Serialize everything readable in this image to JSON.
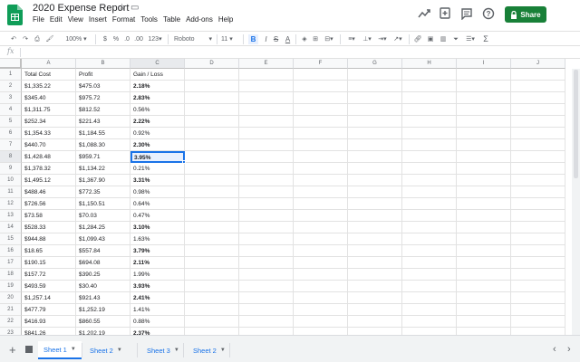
{
  "app": {
    "doc_title": "2020 Expense Report",
    "menu": [
      "File",
      "Edit",
      "View",
      "Insert",
      "Format",
      "Tools",
      "Table",
      "Add-ons",
      "Help"
    ],
    "share_label": "Share",
    "brand_color": "#188038",
    "accent_color": "#1a73e8"
  },
  "toolbar": {
    "zoom": "100%",
    "currency": "$",
    "percent": "%",
    "decimals_less": ".0",
    "decimals_more": ".00",
    "format_more": "123",
    "font": "Roboto",
    "font_size": "11",
    "bold": "B",
    "italic": "I",
    "strike": "S",
    "text_color": "A",
    "functions": "Σ"
  },
  "formula_bar": {
    "fx": "fx",
    "value": ""
  },
  "grid": {
    "columns": [
      "A",
      "B",
      "C",
      "D",
      "E",
      "F",
      "G",
      "H",
      "I",
      "J"
    ],
    "row_numbers": [
      "1",
      "2",
      "3",
      "4",
      "5",
      "6",
      "7",
      "8",
      "9",
      "10",
      "11",
      "12",
      "13",
      "14",
      "15",
      "16",
      "17",
      "18",
      "19",
      "20",
      "21",
      "22",
      "23"
    ],
    "rows": [
      [
        "Total Cost",
        "Profit",
        "Gain / Loss"
      ],
      [
        "$1,335.22",
        "$475.03",
        "2.18%"
      ],
      [
        "$345.40",
        "$975.72",
        "2.83%"
      ],
      [
        "$1,311.75",
        "$812.52",
        "0.56%"
      ],
      [
        "$252.34",
        "$221.43",
        "2.22%"
      ],
      [
        "$1,354.33",
        "$1,184.55",
        "0.92%"
      ],
      [
        "$440.70",
        "$1,088.30",
        "2.30%"
      ],
      [
        "$1,428.48",
        "$959.71",
        "3.95%"
      ],
      [
        "$1,378.32",
        "$1,134.22",
        "0.21%"
      ],
      [
        "$1,495.12",
        "$1,367.90",
        "3.31%"
      ],
      [
        "$488.46",
        "$772.35",
        "0.98%"
      ],
      [
        "$726.56",
        "$1,150.51",
        "0.64%"
      ],
      [
        "$73.58",
        "$70.03",
        "0.47%"
      ],
      [
        "$528.33",
        "$1,284.25",
        "3.10%"
      ],
      [
        "$944.88",
        "$1,099.43",
        "1.63%"
      ],
      [
        "$18.65",
        "$557.84",
        "3.79%"
      ],
      [
        "$190.15",
        "$694.08",
        "2.11%"
      ],
      [
        "$157.72",
        "$390.25",
        "1.99%"
      ],
      [
        "$493.59",
        "$30.40",
        "3.93%"
      ],
      [
        "$1,257.14",
        "$921.43",
        "2.41%"
      ],
      [
        "$477.79",
        "$1,252.19",
        "1.41%"
      ],
      [
        "$416.93",
        "$860.55",
        "0.88%"
      ],
      [
        "$841.26",
        "$1,202.19",
        "2.37%"
      ]
    ],
    "bold_gain": [
      false,
      true,
      true,
      false,
      true,
      false,
      true,
      true,
      false,
      true,
      false,
      false,
      false,
      true,
      false,
      true,
      true,
      false,
      true,
      true,
      false,
      false,
      true
    ],
    "active_cell": "C8"
  },
  "sheets": [
    {
      "label": "Sheet 1",
      "active": true
    },
    {
      "label": "Sheet 2",
      "active": false
    },
    {
      "label": "Sheet 3",
      "active": false
    },
    {
      "label": "Sheet 2",
      "active": false
    }
  ]
}
